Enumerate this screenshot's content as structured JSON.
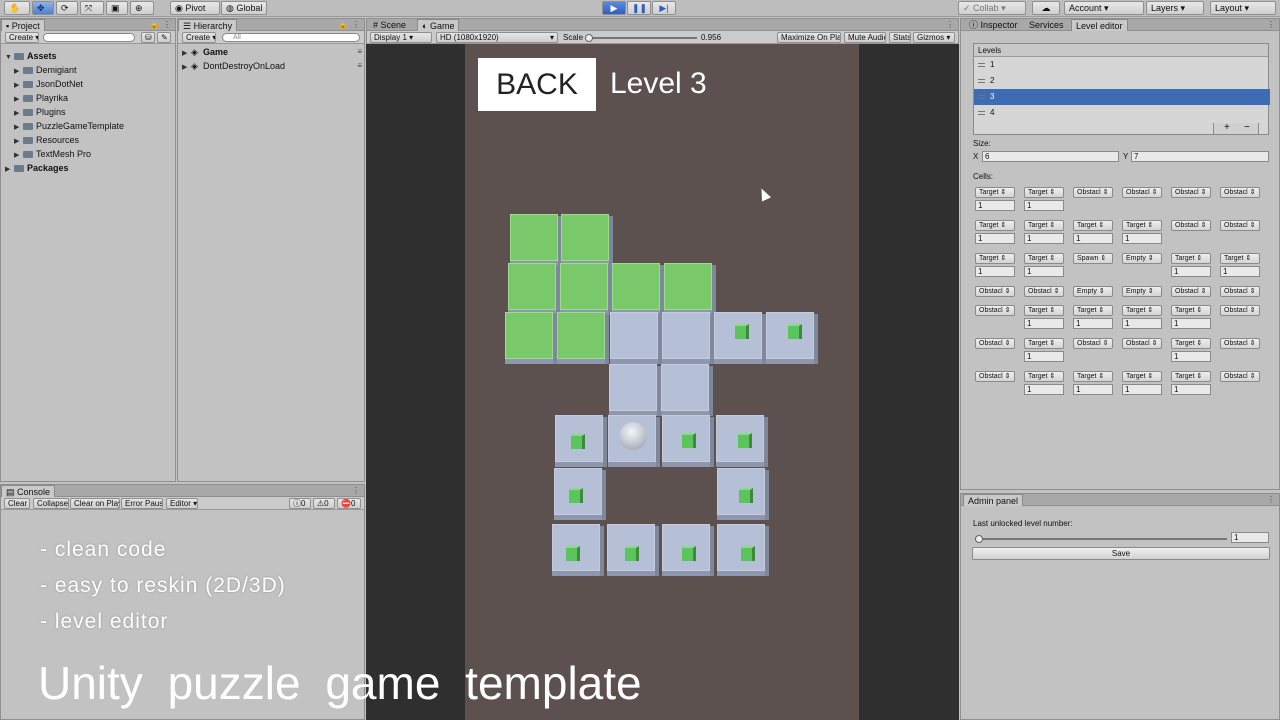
{
  "toolbar": {
    "pivot": "Pivot",
    "global": "Global",
    "collab": "Collab",
    "account": "Account",
    "layers": "Layers",
    "layout": "Layout"
  },
  "project": {
    "tab": "Project",
    "create": "Create",
    "root": "Assets",
    "items": [
      "Demigiant",
      "JsonDotNet",
      "Playrika",
      "Plugins",
      "PuzzleGameTemplate",
      "Resources",
      "TextMesh Pro"
    ],
    "packages": "Packages"
  },
  "hierarchy": {
    "tab": "Hierarchy",
    "create": "Create",
    "search_placeholder": "All",
    "items": [
      "Game",
      "DontDestroyOnLoad"
    ]
  },
  "console": {
    "tab": "Console",
    "buttons": [
      "Clear",
      "Collapse",
      "Clear on Play",
      "Error Pause",
      "Editor"
    ],
    "counts": [
      "0",
      "0",
      "0"
    ]
  },
  "game_view": {
    "tabs": [
      "Scene",
      "Game"
    ],
    "display": "Display 1",
    "resolution": "HD (1080x1920)",
    "scale_label": "Scale",
    "scale_value": "0.956",
    "maximize": "Maximize On Play",
    "mute": "Mute Audio",
    "stats": "Stats",
    "gizmos": "Gizmos",
    "back_button": "BACK",
    "level_title": "Level 3"
  },
  "inspector": {
    "tabs": [
      "Inspector",
      "Services",
      "Level editor"
    ],
    "levels_header": "Levels",
    "levels": [
      "1",
      "2",
      "3",
      "4"
    ],
    "selected_level_index": 2,
    "size_label": "Size:",
    "x_label": "X",
    "x_value": "6",
    "y_label": "Y",
    "y_value": "7",
    "cells_label": "Cells:",
    "cells": [
      [
        [
          "Target",
          "1"
        ],
        [
          "Target",
          "1"
        ],
        [
          "Obstacl",
          ""
        ],
        [
          "Obstacl",
          ""
        ],
        [
          "Obstacl",
          ""
        ],
        [
          "Obstacl",
          ""
        ]
      ],
      [
        [
          "Target",
          "1"
        ],
        [
          "Target",
          "1"
        ],
        [
          "Target",
          "1"
        ],
        [
          "Target",
          "1"
        ],
        [
          "Obstacl",
          ""
        ],
        [
          "Obstacl",
          ""
        ]
      ],
      [
        [
          "Target",
          "1"
        ],
        [
          "Target",
          "1"
        ],
        [
          "Spawn",
          ""
        ],
        [
          "Empty",
          ""
        ],
        [
          "Target",
          "1"
        ],
        [
          "Target",
          "1"
        ]
      ],
      [
        [
          "Obstacl",
          ""
        ],
        [
          "Obstacl",
          ""
        ],
        [
          "Empty",
          ""
        ],
        [
          "Empty",
          ""
        ],
        [
          "Obstacl",
          ""
        ],
        [
          "Obstacl",
          ""
        ]
      ],
      [
        [
          "Obstacl",
          ""
        ],
        [
          "Target",
          "1"
        ],
        [
          "Target",
          "1"
        ],
        [
          "Target",
          "1"
        ],
        [
          "Target",
          "1"
        ],
        [
          "Obstacl",
          ""
        ]
      ],
      [
        [
          "Obstacl",
          ""
        ],
        [
          "Target",
          "1"
        ],
        [
          "Obstacl",
          ""
        ],
        [
          "Obstacl",
          ""
        ],
        [
          "Target",
          "1"
        ],
        [
          "Obstacl",
          ""
        ]
      ],
      [
        [
          "Obstacl",
          ""
        ],
        [
          "Target",
          "1"
        ],
        [
          "Target",
          "1"
        ],
        [
          "Target",
          "1"
        ],
        [
          "Target",
          "1"
        ],
        [
          "Obstacl",
          ""
        ]
      ]
    ]
  },
  "admin": {
    "tab": "Admin panel",
    "label": "Last unlocked level number:",
    "value": "1",
    "slider_fraction": 0,
    "save": "Save"
  },
  "overlay": {
    "bullets": [
      "- clean code",
      "- easy to reskin (2D/3D)",
      "- level editor"
    ],
    "title": "Unity puzzle game template"
  },
  "colors": {
    "target_green": "#79c96b",
    "floor_blue": "#b5bfd6",
    "selected_row": "#3d6bb4",
    "game_background": "#5c514e"
  }
}
